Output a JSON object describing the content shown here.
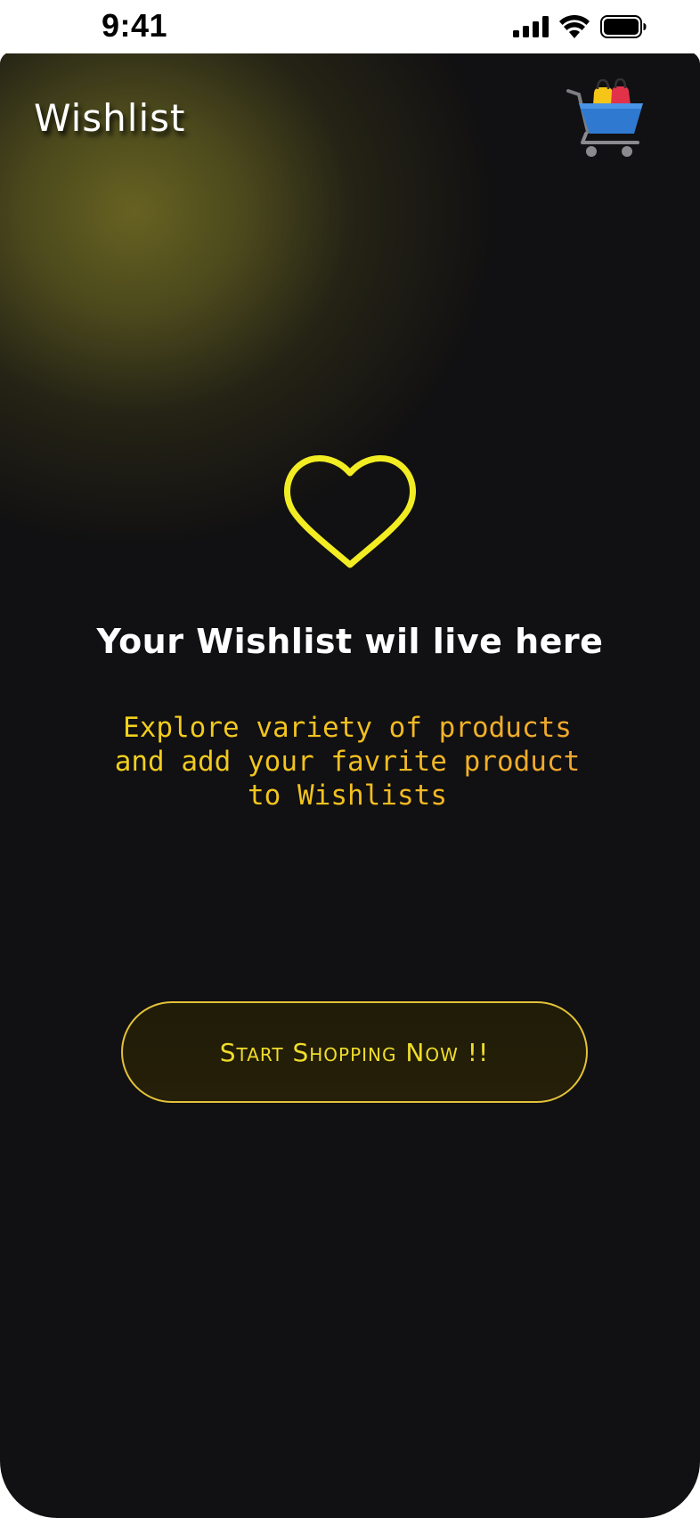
{
  "status_bar": {
    "time": "9:41",
    "icons": [
      "signal-icon",
      "wifi-icon",
      "battery-icon"
    ]
  },
  "header": {
    "title": "Wishlist",
    "cart_icon": "shopping-cart-icon"
  },
  "empty_state": {
    "icon": "heart-outline-icon",
    "title": "Your Wishlist wil live here",
    "description": "Explore variety of products\nand add your favrite product\nto Wishlists"
  },
  "cta": {
    "label": "Start Shopping Now !!"
  },
  "colors": {
    "background": "#111012",
    "accent_yellow": "#f0e62a",
    "heart_stroke": "#f2ec22",
    "text_orange": "#f0a030",
    "white": "#ffffff"
  }
}
